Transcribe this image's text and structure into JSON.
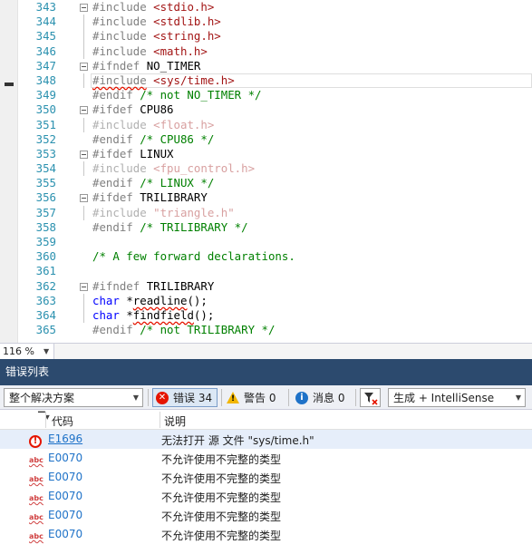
{
  "editor": {
    "lines": [
      {
        "num": "343",
        "fold": true,
        "guide": false,
        "parts": [
          {
            "t": "#include ",
            "c": "d"
          },
          {
            "t": "<stdio.h>",
            "c": "s"
          }
        ]
      },
      {
        "num": "344",
        "fold": false,
        "guide": true,
        "parts": [
          {
            "t": "#include ",
            "c": "d"
          },
          {
            "t": "<stdlib.h>",
            "c": "s"
          }
        ]
      },
      {
        "num": "345",
        "fold": false,
        "guide": true,
        "parts": [
          {
            "t": "#include ",
            "c": "d"
          },
          {
            "t": "<string.h>",
            "c": "s"
          }
        ]
      },
      {
        "num": "346",
        "fold": false,
        "guide": true,
        "parts": [
          {
            "t": "#include ",
            "c": "d"
          },
          {
            "t": "<math.h>",
            "c": "s"
          }
        ]
      },
      {
        "num": "347",
        "fold": true,
        "guide": false,
        "parts": [
          {
            "t": "#ifndef ",
            "c": "d"
          },
          {
            "t": "NO_TIMER",
            "c": "n"
          }
        ]
      },
      {
        "num": "348",
        "fold": false,
        "guide": true,
        "current": true,
        "parts": [
          {
            "t": "#include",
            "c": "d squig"
          },
          {
            "t": " ",
            "c": "d"
          },
          {
            "t": "<sys/time.h>",
            "c": "s"
          }
        ]
      },
      {
        "num": "349",
        "fold": false,
        "guide": false,
        "parts": [
          {
            "t": "#endif ",
            "c": "d"
          },
          {
            "t": "/* not NO_TIMER */",
            "c": "c"
          }
        ]
      },
      {
        "num": "350",
        "fold": true,
        "guide": false,
        "parts": [
          {
            "t": "#ifdef ",
            "c": "d"
          },
          {
            "t": "CPU86",
            "c": "n"
          }
        ]
      },
      {
        "num": "351",
        "fold": false,
        "guide": true,
        "parts": [
          {
            "t": "#include ",
            "c": "gd"
          },
          {
            "t": "<float.h>",
            "c": "gs"
          }
        ]
      },
      {
        "num": "352",
        "fold": false,
        "guide": false,
        "parts": [
          {
            "t": "#endif ",
            "c": "d"
          },
          {
            "t": "/* CPU86 */",
            "c": "c"
          }
        ]
      },
      {
        "num": "353",
        "fold": true,
        "guide": false,
        "parts": [
          {
            "t": "#ifdef ",
            "c": "d"
          },
          {
            "t": "LINUX",
            "c": "n"
          }
        ]
      },
      {
        "num": "354",
        "fold": false,
        "guide": true,
        "parts": [
          {
            "t": "#include ",
            "c": "gd"
          },
          {
            "t": "<fpu_control.h>",
            "c": "gs"
          }
        ]
      },
      {
        "num": "355",
        "fold": false,
        "guide": false,
        "parts": [
          {
            "t": "#endif ",
            "c": "d"
          },
          {
            "t": "/* LINUX */",
            "c": "c"
          }
        ]
      },
      {
        "num": "356",
        "fold": true,
        "guide": false,
        "parts": [
          {
            "t": "#ifdef ",
            "c": "d"
          },
          {
            "t": "TRILIBRARY",
            "c": "n"
          }
        ]
      },
      {
        "num": "357",
        "fold": false,
        "guide": true,
        "parts": [
          {
            "t": "#include ",
            "c": "gd"
          },
          {
            "t": "\"triangle.h\"",
            "c": "gs"
          }
        ]
      },
      {
        "num": "358",
        "fold": false,
        "guide": false,
        "parts": [
          {
            "t": "#endif ",
            "c": "d"
          },
          {
            "t": "/* TRILIBRARY */",
            "c": "c"
          }
        ]
      },
      {
        "num": "359",
        "fold": false,
        "guide": false,
        "parts": []
      },
      {
        "num": "360",
        "fold": false,
        "guide": false,
        "parts": [
          {
            "t": "/* A few forward declarations.",
            "c": "c"
          }
        ]
      },
      {
        "num": "361",
        "fold": false,
        "guide": false,
        "parts": []
      },
      {
        "num": "362",
        "fold": true,
        "guide": false,
        "parts": [
          {
            "t": "#ifndef ",
            "c": "d"
          },
          {
            "t": "TRILIBRARY",
            "c": "n"
          }
        ]
      },
      {
        "num": "363",
        "fold": false,
        "guide": true,
        "parts": [
          {
            "t": "char ",
            "c": "k"
          },
          {
            "t": "*",
            "c": "n"
          },
          {
            "t": "readline",
            "c": "n squig"
          },
          {
            "t": "();",
            "c": "n"
          }
        ]
      },
      {
        "num": "364",
        "fold": false,
        "guide": true,
        "parts": [
          {
            "t": "char ",
            "c": "k"
          },
          {
            "t": "*",
            "c": "n"
          },
          {
            "t": "findfield",
            "c": "n squig"
          },
          {
            "t": "();",
            "c": "n"
          }
        ]
      },
      {
        "num": "365",
        "fold": false,
        "guide": false,
        "parts": [
          {
            "t": "#endif ",
            "c": "d"
          },
          {
            "t": "/* not TRILIBRARY */",
            "c": "c"
          }
        ]
      }
    ]
  },
  "zoom": {
    "value": "116 %"
  },
  "errorList": {
    "title": "错误列表",
    "scope": "整个解决方案",
    "errors": {
      "label": "错误 34",
      "icon": "error-icon"
    },
    "warnings": {
      "label": "警告 0",
      "icon": "warning-icon"
    },
    "messages": {
      "label": "消息 0",
      "icon": "info-icon"
    },
    "build": "生成 + IntelliSense",
    "columns": {
      "code": "代码",
      "description": "说明"
    },
    "rows": [
      {
        "icon": "error",
        "code": "E1696",
        "desc": "无法打开 源 文件 \"sys/time.h\"",
        "selected": true,
        "link": true
      },
      {
        "icon": "abc",
        "code": "E0070",
        "desc": "不允许使用不完整的类型"
      },
      {
        "icon": "abc",
        "code": "E0070",
        "desc": "不允许使用不完整的类型"
      },
      {
        "icon": "abc",
        "code": "E0070",
        "desc": "不允许使用不完整的类型"
      },
      {
        "icon": "abc",
        "code": "E0070",
        "desc": "不允许使用不完整的类型"
      },
      {
        "icon": "abc",
        "code": "E0070",
        "desc": "不允许使用不完整的类型"
      }
    ]
  }
}
